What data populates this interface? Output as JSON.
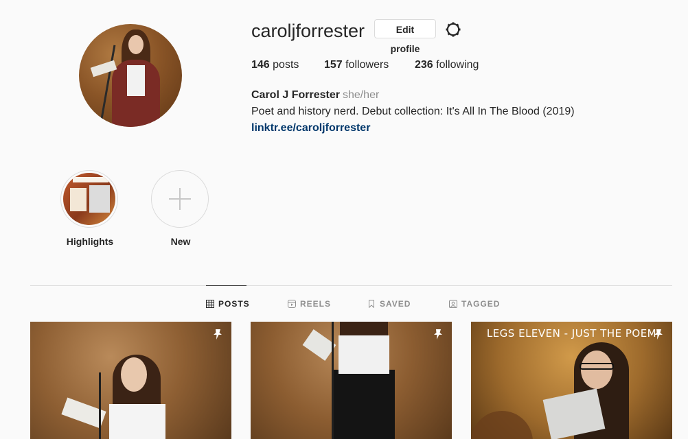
{
  "profile": {
    "username": "caroljforrester",
    "edit_profile_label": "Edit profile",
    "settings_icon": "gear-icon",
    "stats": {
      "posts": "146",
      "posts_label": "posts",
      "followers": "157",
      "followers_label": "followers",
      "following": "236",
      "following_label": "following"
    },
    "full_name": "Carol J Forrester",
    "pronouns": "she/her",
    "bio": "Poet and history nerd. Debut collection: It's All In The Blood (2019)",
    "link": "linktr.ee/caroljforrester"
  },
  "highlights": [
    {
      "label": "Highlights"
    },
    {
      "label": "New"
    }
  ],
  "tabs": [
    {
      "label": "POSTS",
      "icon": "grid-icon",
      "active": true
    },
    {
      "label": "REELS",
      "icon": "reels-icon",
      "active": false
    },
    {
      "label": "SAVED",
      "icon": "bookmark-icon",
      "active": false
    },
    {
      "label": "TAGGED",
      "icon": "tagged-icon",
      "active": false
    }
  ],
  "posts": [
    {
      "pinned": true,
      "caption": ""
    },
    {
      "pinned": true,
      "caption": ""
    },
    {
      "pinned": true,
      "caption": "LEGS ELEVEN - JUST THE POEM"
    }
  ],
  "colors": {
    "background": "#fafafa",
    "text": "#262626",
    "muted": "#8e8e8e",
    "link": "#00376b",
    "border": "#dbdbdb"
  }
}
